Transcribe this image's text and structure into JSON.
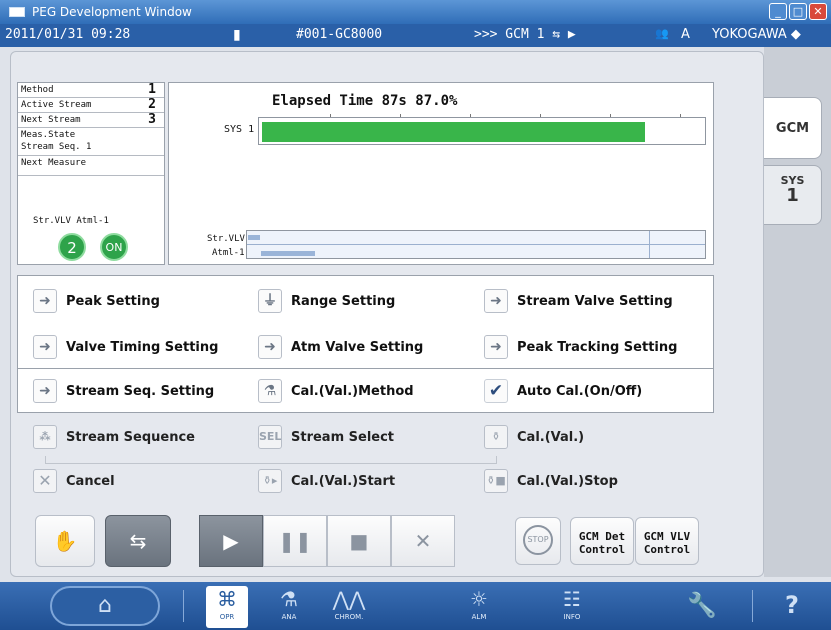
{
  "window": {
    "title": "PEG Development Window"
  },
  "statusbar": {
    "datetime": "2011/01/31 09:28",
    "analyzer": "#001-GC8000",
    "gcm_info": ">>> GCM 1 ⇆ ▶",
    "user_level": "A",
    "brand": "YOKOGAWA ◆"
  },
  "info": {
    "method_label": "Method",
    "method_value": "1",
    "active_stream_label": "Active Stream",
    "active_stream_value": "2",
    "next_stream_label": "Next Stream",
    "next_stream_value": "3",
    "meas_state_label": "Meas.State",
    "stream_seq_label": "Stream Seq. 1",
    "next_measure_label": "Next Measure",
    "strvlv_label": "Str.VLV Atml-1",
    "strvlv_value": "2",
    "atml_value": "ON"
  },
  "chart": {
    "elapsed_text": "Elapsed Time  87s  87.0%",
    "progress_fraction": 0.87,
    "sys_label": "SYS 1",
    "vlv_label1": "Str.VLV",
    "vlv_label2": "Atml-1"
  },
  "settings": {
    "peak": "Peak Setting",
    "range": "Range Setting",
    "stream_valve": "Stream Valve Setting",
    "valve_timing": "Valve Timing Setting",
    "atm_valve": "Atm Valve Setting",
    "peak_tracking": "Peak Tracking Setting",
    "stream_seq": "Stream Seq. Setting",
    "cal_method": "Cal.(Val.)Method",
    "auto_cal": "Auto Cal.(On/Off)"
  },
  "actions": {
    "stream_sequence": "Stream Sequence",
    "stream_select": "Stream Select",
    "cal_val": "Cal.(Val.)",
    "cancel": "Cancel",
    "cal_start": "Cal.(Val.)Start",
    "cal_stop": "Cal.(Val.)Stop"
  },
  "controls": {
    "stop_label": "STOP",
    "gcm_det_line1": "GCM Det",
    "gcm_det_line2": "Control",
    "gcm_vlv_line1": "GCM VLV",
    "gcm_vlv_line2": "Control"
  },
  "side_tabs": {
    "gcm": "GCM",
    "sys_label": "SYS",
    "sys_num": "1"
  },
  "nav": {
    "opr": "OPR",
    "ana": "ANA",
    "chrom": "CHROM.",
    "alm": "ALM",
    "info": "INFO"
  },
  "colors": {
    "progress": "#39b54a",
    "status_bar": "#2a60a8",
    "nav_bar": "#1f4f92"
  }
}
